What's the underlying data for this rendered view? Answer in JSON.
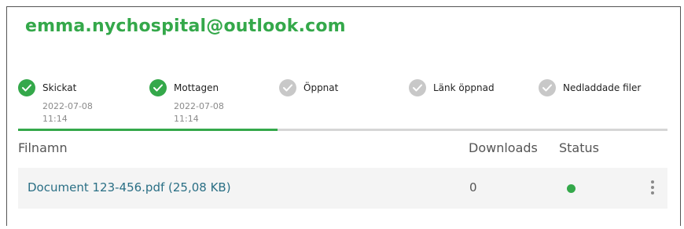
{
  "recipient": {
    "email": "emma.nychospital@outlook.com"
  },
  "steps": [
    {
      "label": "Skickat",
      "date": "2022-07-08",
      "time": "11:14",
      "status": "done",
      "icon": "check-icon"
    },
    {
      "label": "Mottagen",
      "date": "2022-07-08",
      "time": "11:14",
      "status": "done",
      "icon": "check-icon"
    },
    {
      "label": "Öppnat",
      "status": "pending",
      "icon": "check-icon"
    },
    {
      "label": "Länk öppnad",
      "status": "pending",
      "icon": "check-icon"
    },
    {
      "label": "Nedladdade filer",
      "status": "pending",
      "icon": "check-icon"
    }
  ],
  "progress": {
    "completed_steps": 2,
    "total_steps": 5,
    "fraction": 0.4
  },
  "table": {
    "headers": {
      "filename": "Filnamn",
      "downloads": "Downloads",
      "status": "Status"
    },
    "rows": [
      {
        "filename": "Document 123-456.pdf (25,08 KB)",
        "downloads": "0",
        "status_icon": "status-dot"
      }
    ]
  },
  "colors": {
    "accent": "#34a84a",
    "pending": "#c8c8c8",
    "link": "#2a6f85"
  }
}
